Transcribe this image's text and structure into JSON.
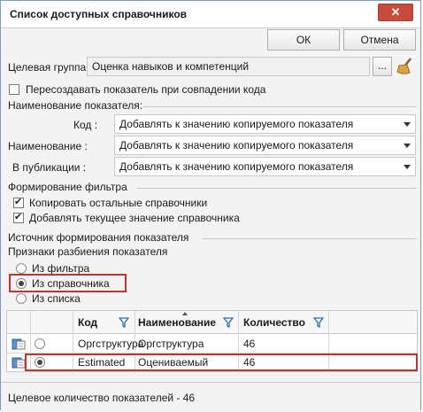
{
  "window": {
    "title": "Список доступных справочников",
    "close_symbol": "✕"
  },
  "buttons": {
    "ok": "ОК",
    "cancel": "Отмена",
    "more": "..."
  },
  "target_group": {
    "label": "Целевая группа:",
    "value": "Оценка навыков и компетенций"
  },
  "recreate_checkbox": {
    "label": "Пересоздавать показатель при совпадении кода",
    "checked": false
  },
  "naming": {
    "section_title": "Наименование показателя:",
    "rows": [
      {
        "label": "Код :",
        "value": "Добавлять к значению копируемого показателя"
      },
      {
        "label": "Наименование :",
        "value": "Добавлять к значению копируемого показателя"
      },
      {
        "label": "В публикации :",
        "value": "Добавлять к значению копируемого показателя"
      }
    ]
  },
  "filter": {
    "section_title": "Формирование фильтра",
    "options": [
      {
        "label": "Копировать остальные справочники",
        "checked": true
      },
      {
        "label": "Добавлять текущее значение справочника",
        "checked": true
      }
    ]
  },
  "source": {
    "section_title": "Источник формирования показателя",
    "subtitle": "Признаки разбиения показателя",
    "options": [
      {
        "label": "Из фильтра",
        "selected": false
      },
      {
        "label": "Из справочника",
        "selected": true
      },
      {
        "label": "Из списка",
        "selected": false
      }
    ]
  },
  "grid": {
    "columns": [
      "Код",
      "Наименование",
      "Количество"
    ],
    "rows": [
      {
        "code": "Оргструктура",
        "name": "Оргструктура",
        "count": "46",
        "selected": false
      },
      {
        "code": "Estimated",
        "name": "Оцениваемый",
        "count": "46",
        "selected": true
      }
    ]
  },
  "status": {
    "text": "Целевое количество показателей - 46"
  },
  "colors": {
    "highlight": "#b03a2e",
    "close": "#c94b3c",
    "border": "#7a9cc4"
  }
}
